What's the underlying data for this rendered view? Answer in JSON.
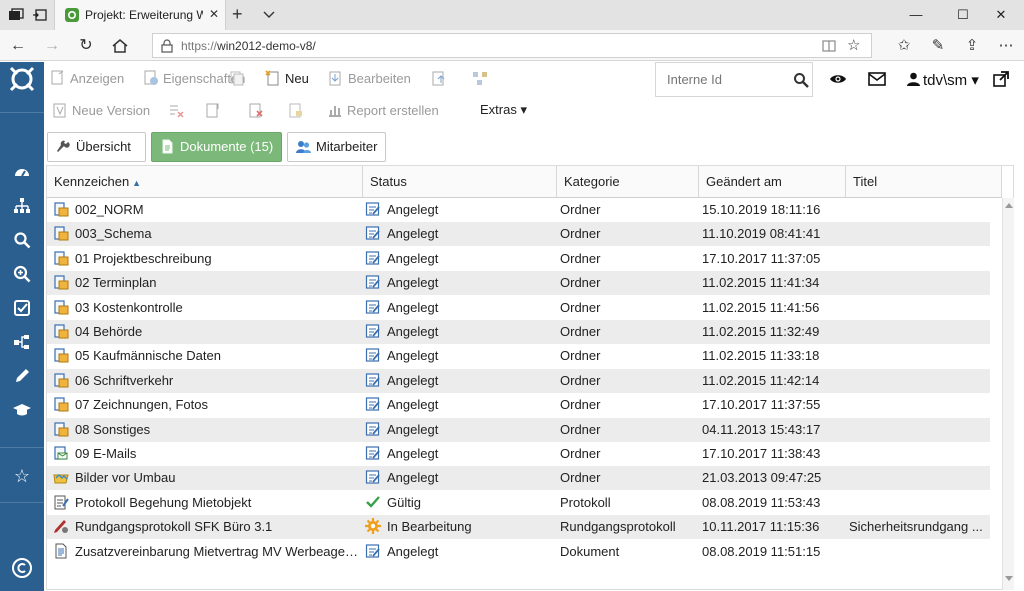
{
  "browser": {
    "tab_title": "Projekt: Erweiterung We",
    "url_scheme": "https://",
    "url_host": "win2012-demo-v8/"
  },
  "toolbar": {
    "row1": [
      {
        "label": "Anzeigen",
        "enabled": false,
        "icon": "view-icon"
      },
      {
        "label": "Eigenschaften",
        "enabled": false,
        "icon": "properties-icon"
      },
      {
        "label": "",
        "enabled": false,
        "icon": "copy-icon"
      },
      {
        "label": "Neu",
        "enabled": true,
        "icon": "new-document-icon"
      },
      {
        "label": "Bearbeiten",
        "enabled": false,
        "icon": "edit-download-icon"
      },
      {
        "label": "",
        "enabled": false,
        "icon": "upload-icon"
      },
      {
        "label": "",
        "enabled": false,
        "icon": "workflow-icon"
      }
    ],
    "row2": [
      {
        "label": "Neue Version",
        "enabled": false,
        "icon": "new-version-icon"
      },
      {
        "label": "",
        "enabled": false,
        "icon": "delete-link-icon"
      },
      {
        "label": "",
        "enabled": false,
        "icon": "delete-doc-icon"
      },
      {
        "label": "",
        "enabled": false,
        "icon": "remove-icon"
      },
      {
        "label": "",
        "enabled": false,
        "icon": "lock-doc-icon"
      },
      {
        "label": "Report erstellen",
        "enabled": false,
        "icon": "report-icon"
      }
    ],
    "extras_label": "Extras ▾",
    "search_placeholder": "Interne Id",
    "user_label": "tdv\\sm ▾"
  },
  "tabs": [
    {
      "label": "Übersicht",
      "active": false,
      "icon": "wrench-icon"
    },
    {
      "label": "Dokumente (15)",
      "active": true,
      "icon": "document-icon"
    },
    {
      "label": "Mitarbeiter",
      "active": false,
      "icon": "users-icon"
    }
  ],
  "table": {
    "columns": [
      "Kennzeichen",
      "Status",
      "Kategorie",
      "Geändert am",
      "Titel"
    ],
    "rows": [
      {
        "kz": "002_NORM",
        "icon": "folder-doc-icon",
        "status": "Angelegt",
        "status_icon": "edit-note-icon",
        "kat": "Ordner",
        "ge": "15.10.2019 18:11:16",
        "ti": ""
      },
      {
        "kz": "003_Schema",
        "icon": "folder-doc-icon",
        "status": "Angelegt",
        "status_icon": "edit-note-icon",
        "kat": "Ordner",
        "ge": "11.10.2019 08:41:41",
        "ti": ""
      },
      {
        "kz": "01 Projektbeschreibung",
        "icon": "folder-doc-icon",
        "status": "Angelegt",
        "status_icon": "edit-note-icon",
        "kat": "Ordner",
        "ge": "17.10.2017 11:37:05",
        "ti": ""
      },
      {
        "kz": "02 Terminplan",
        "icon": "folder-doc-icon",
        "status": "Angelegt",
        "status_icon": "edit-note-icon",
        "kat": "Ordner",
        "ge": "11.02.2015 11:41:34",
        "ti": ""
      },
      {
        "kz": "03 Kostenkontrolle",
        "icon": "folder-doc-icon",
        "status": "Angelegt",
        "status_icon": "edit-note-icon",
        "kat": "Ordner",
        "ge": "11.02.2015 11:41:56",
        "ti": ""
      },
      {
        "kz": "04 Behörde",
        "icon": "folder-doc-icon",
        "status": "Angelegt",
        "status_icon": "edit-note-icon",
        "kat": "Ordner",
        "ge": "11.02.2015 11:32:49",
        "ti": ""
      },
      {
        "kz": "05 Kaufmännische Daten",
        "icon": "folder-doc-icon",
        "status": "Angelegt",
        "status_icon": "edit-note-icon",
        "kat": "Ordner",
        "ge": "11.02.2015 11:33:18",
        "ti": ""
      },
      {
        "kz": "06 Schriftverkehr",
        "icon": "folder-doc-icon",
        "status": "Angelegt",
        "status_icon": "edit-note-icon",
        "kat": "Ordner",
        "ge": "11.02.2015 11:42:14",
        "ti": ""
      },
      {
        "kz": "07 Zeichnungen, Fotos",
        "icon": "folder-doc-icon",
        "status": "Angelegt",
        "status_icon": "edit-note-icon",
        "kat": "Ordner",
        "ge": "17.10.2017 11:37:55",
        "ti": ""
      },
      {
        "kz": "08 Sonstiges",
        "icon": "folder-doc-icon",
        "status": "Angelegt",
        "status_icon": "edit-note-icon",
        "kat": "Ordner",
        "ge": "04.11.2013 15:43:17",
        "ti": ""
      },
      {
        "kz": "09 E-Mails",
        "icon": "mail-doc-icon",
        "status": "Angelegt",
        "status_icon": "edit-note-icon",
        "kat": "Ordner",
        "ge": "17.10.2017 11:38:43",
        "ti": ""
      },
      {
        "kz": "Bilder vor Umbau",
        "icon": "image-folder-icon",
        "status": "Angelegt",
        "status_icon": "edit-note-icon",
        "kat": "Ordner",
        "ge": "21.03.2013 09:47:25",
        "ti": ""
      },
      {
        "kz": "Protokoll Begehung Mietobjekt",
        "icon": "protocol-icon",
        "status": "Gültig",
        "status_icon": "check-icon",
        "kat": "Protokoll",
        "ge": "08.08.2019 11:53:43",
        "ti": ""
      },
      {
        "kz": "Rundgangsprotokoll SFK Büro 3.1",
        "icon": "pen-protocol-icon",
        "status": "In Bearbeitung",
        "status_icon": "gear-icon",
        "kat": "Rundgangsprotokoll",
        "ge": "10.11.2017 11:15:36",
        "ti": "Sicherheitsrundgang ..."
      },
      {
        "kz": "Zusatzvereinbarung Mietvertrag MV Werbeagen...",
        "icon": "text-doc-icon",
        "status": "Angelegt",
        "status_icon": "edit-note-icon",
        "kat": "Dokument",
        "ge": "08.08.2019 11:51:15",
        "ti": ""
      }
    ]
  },
  "colors": {
    "sidebar": "#2a5f8f",
    "active_tab": "#7cb87a",
    "row_alt": "#ececec"
  }
}
